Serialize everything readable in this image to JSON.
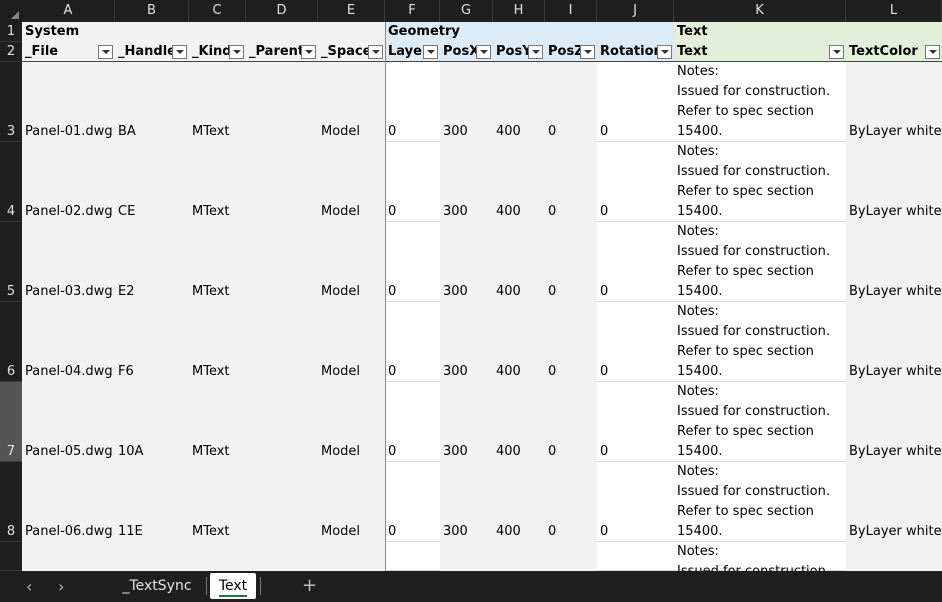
{
  "columns": [
    "A",
    "B",
    "C",
    "D",
    "E",
    "F",
    "G",
    "H",
    "I",
    "J",
    "K",
    "L"
  ],
  "group_headers": {
    "system": "System",
    "geometry": "Geometry",
    "text": "Text"
  },
  "field_headers": [
    "_File",
    "_Handle",
    "_Kind",
    "_Parent",
    "_Space",
    "Layer",
    "PosX",
    "PosY",
    "PosZ",
    "Rotation",
    "Text",
    "TextColor"
  ],
  "rows": [
    {
      "num": "1"
    },
    {
      "num": "2"
    },
    {
      "num": "3",
      "file": "Panel-01.dwg",
      "handle": "BA",
      "kind": "MText",
      "space": "Model",
      "layer": "0",
      "posx": "300",
      "posy": "400",
      "posz": "0",
      "rotation": "0",
      "color": "ByLayer white"
    },
    {
      "num": "4",
      "file": "Panel-02.dwg",
      "handle": "CE",
      "kind": "MText",
      "space": "Model",
      "layer": "0",
      "posx": "300",
      "posy": "400",
      "posz": "0",
      "rotation": "0",
      "color": "ByLayer white"
    },
    {
      "num": "5",
      "file": "Panel-03.dwg",
      "handle": "E2",
      "kind": "MText",
      "space": "Model",
      "layer": "0",
      "posx": "300",
      "posy": "400",
      "posz": "0",
      "rotation": "0",
      "color": "ByLayer white"
    },
    {
      "num": "6",
      "file": "Panel-04.dwg",
      "handle": "F6",
      "kind": "MText",
      "space": "Model",
      "layer": "0",
      "posx": "300",
      "posy": "400",
      "posz": "0",
      "rotation": "0",
      "color": "ByLayer white"
    },
    {
      "num": "7",
      "file": "Panel-05.dwg",
      "handle": "10A",
      "kind": "MText",
      "space": "Model",
      "layer": "0",
      "posx": "300",
      "posy": "400",
      "posz": "0",
      "rotation": "0",
      "color": "ByLayer white"
    },
    {
      "num": "8",
      "file": "Panel-06.dwg",
      "handle": "11E",
      "kind": "MText",
      "space": "Model",
      "layer": "0",
      "posx": "300",
      "posy": "400",
      "posz": "0",
      "rotation": "0",
      "color": "ByLayer white"
    }
  ],
  "text_lines": [
    "Notes:",
    "Issued for construction.",
    "Refer to spec section",
    "15400."
  ],
  "text_partial": [
    "Notes:",
    "Issued for construction."
  ],
  "tabs": {
    "prev": "‹",
    "next": "›",
    "sheet1": "_TextSync",
    "sheet2": "Text",
    "add": "+"
  },
  "colors": {
    "geometry_header": "#ddebf7",
    "text_header": "#e2efda",
    "cell_white": "#ffffff",
    "cell_grey": "#f2f2f2",
    "active_tab_underline": "#107c41"
  }
}
